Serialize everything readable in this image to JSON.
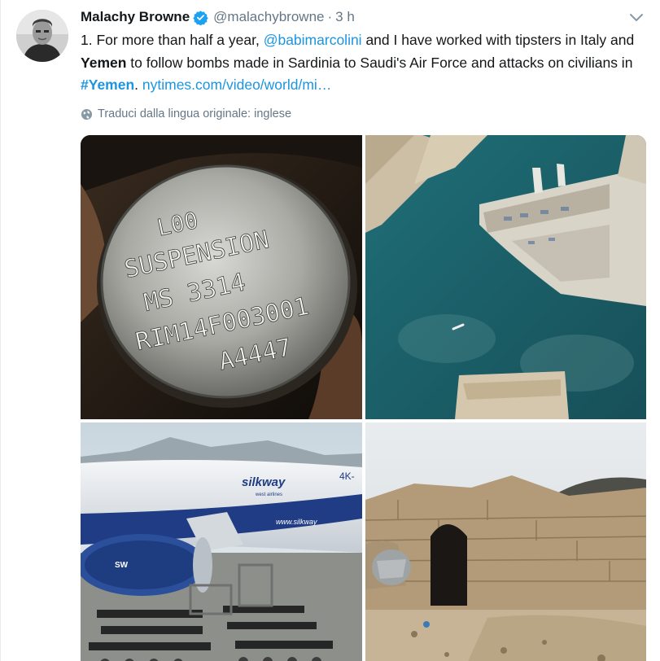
{
  "tweet": {
    "display_name": "Malachy Browne",
    "handle": "@malachybrowne",
    "separator": "·",
    "time": "3 h",
    "text": {
      "part1": "1. For more than half a year, ",
      "mention": "@babimarcolini",
      "part2": " and I have worked with tipsters in Italy and ",
      "bold_yemen": "Yemen",
      "part3": " to follow bombs made in Sardinia to Saudi's Air Force and attacks on civilians in ",
      "hashtag": "#Yemen",
      "part4": ".   ",
      "url": "nytimes.com/video/world/mi…"
    },
    "translate_label": "Traduci dalla lingua originale: inglese",
    "icons": {
      "verified": "verified-badge-icon",
      "caret": "chevron-down-icon",
      "globe": "globe-icon"
    },
    "colors": {
      "link": "#1b95e0",
      "secondary": "#657786",
      "verified": "#1da1f2"
    }
  },
  "media": {
    "photo1": {
      "engraving": [
        "L00",
        "SUSPENSION",
        "MS   3314",
        "RIM14F003001",
        "A4447"
      ]
    },
    "photo3": {
      "aircraft_brand": "silkway",
      "aircraft_sub": "west airlines",
      "aircraft_reg": "4K-",
      "fuselage_text": "www.silkway",
      "engine_logo": "SW"
    }
  }
}
